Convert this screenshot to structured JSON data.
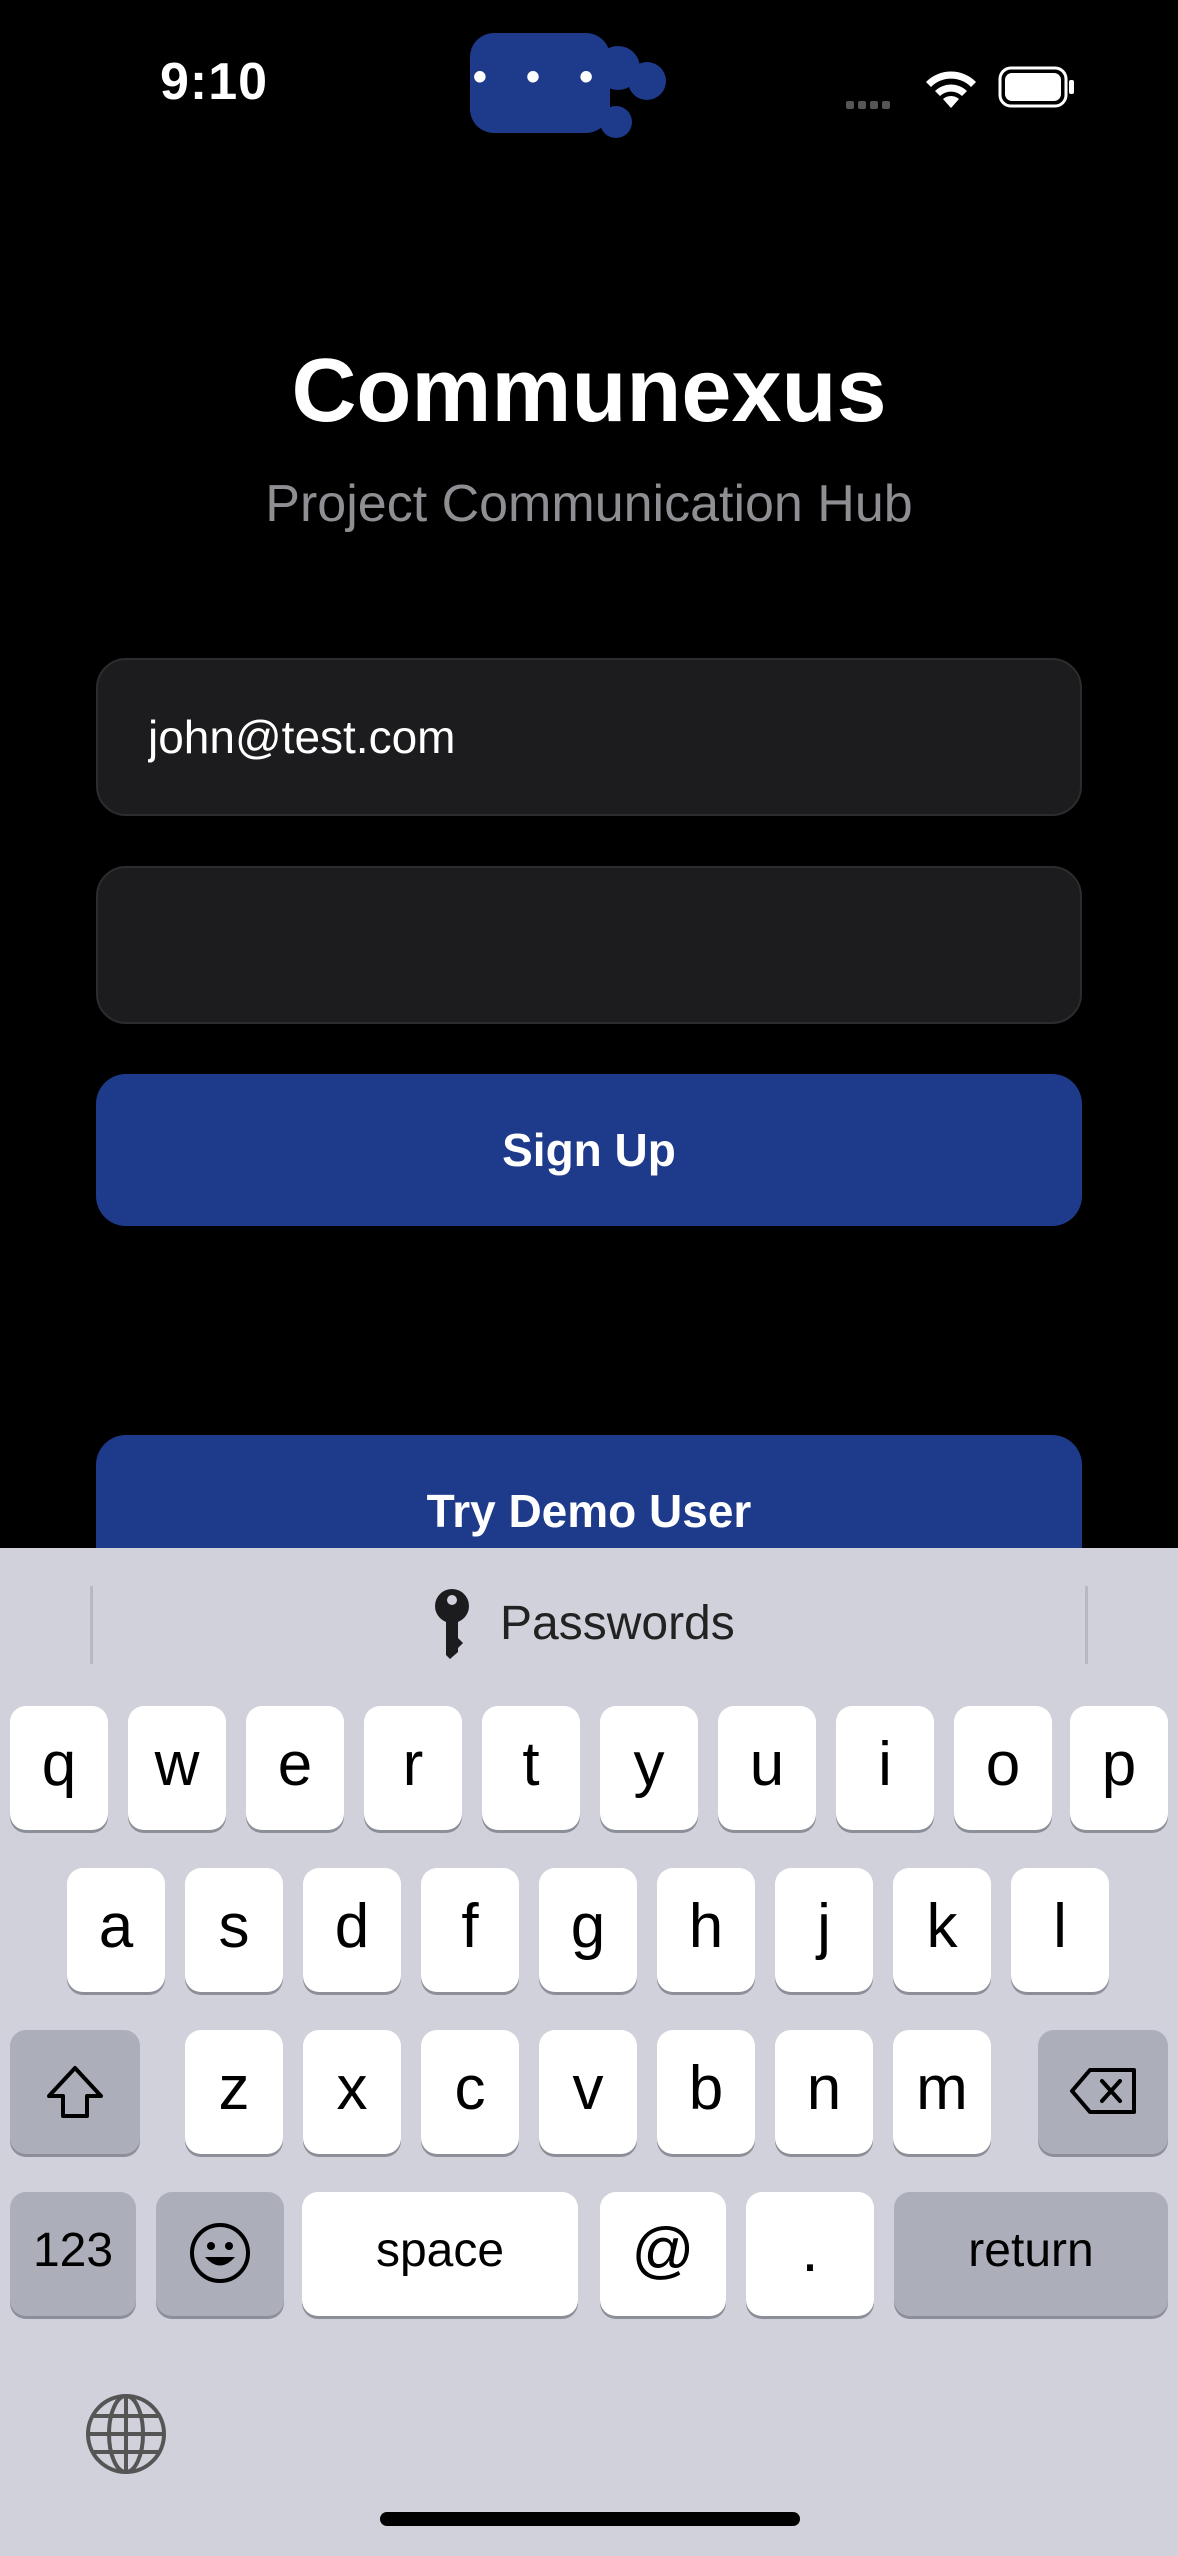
{
  "status_bar": {
    "time": "9:10",
    "island_label": "• • •"
  },
  "header": {
    "title": "Communexus",
    "subtitle": "Project Communication Hub"
  },
  "form": {
    "email_value": "john@test.com",
    "password_value": "",
    "sign_up_label": "Sign Up",
    "demo_label": "Try Demo User"
  },
  "keyboard": {
    "passwords_label": "Passwords",
    "row1": [
      "q",
      "w",
      "e",
      "r",
      "t",
      "y",
      "u",
      "i",
      "o",
      "p"
    ],
    "row2": [
      "a",
      "s",
      "d",
      "f",
      "g",
      "h",
      "j",
      "k",
      "l"
    ],
    "row3": [
      "z",
      "x",
      "c",
      "v",
      "b",
      "n",
      "m"
    ],
    "numbers_label": "123",
    "space_label": "space",
    "at_label": "@",
    "dot_label": ".",
    "return_label": "return"
  },
  "colors": {
    "accent": "#1e3a8a",
    "background": "#000000",
    "field": "#1c1c1e",
    "keyboard": "#d0d1da"
  }
}
